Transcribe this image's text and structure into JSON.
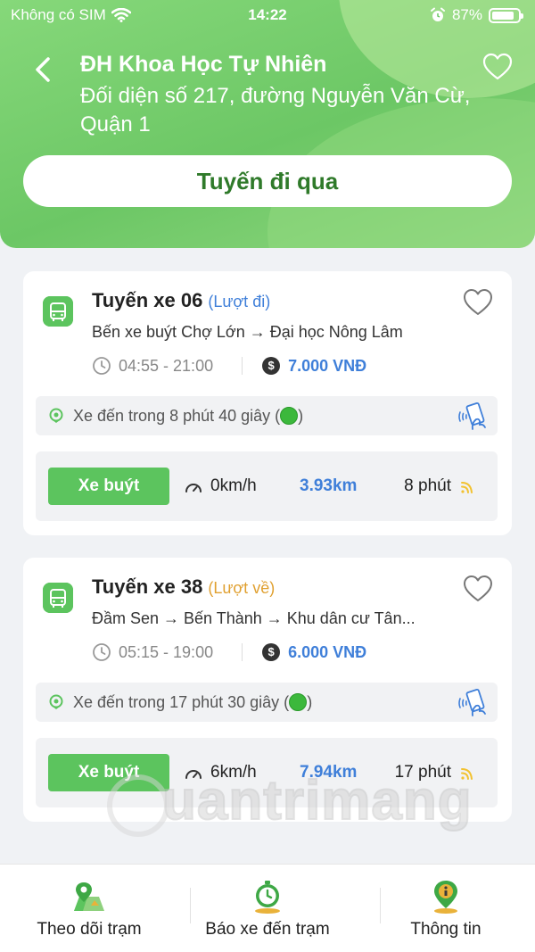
{
  "status_bar": {
    "carrier": "Không có SIM",
    "time": "14:22",
    "battery": "87%",
    "battery_level": 0.87
  },
  "header": {
    "title": "ĐH Khoa Học Tự Nhiên",
    "address": "Đối diện số 217, đường Nguyễn Văn Cừ, Quận 1",
    "routes_button": "Tuyến đi qua"
  },
  "routes": [
    {
      "name": "Tuyến xe 06",
      "direction": "(Lượt đi)",
      "path": "Bến xe buýt Chợ Lớn → Đại học Nông Lâm",
      "hours": "04:55 - 21:00",
      "price": "7.000 VNĐ",
      "arrival": "Xe đến trong 8 phút 40 giây (",
      "arrival_end": ")",
      "vehicle_type": "Xe buýt",
      "speed": "0km/h",
      "distance": "3.93km",
      "eta": "8 phút"
    },
    {
      "name": "Tuyến xe 38",
      "direction": "(Lượt về)",
      "path": "Đầm Sen → Bến Thành → Khu dân cư Tân...",
      "hours": "05:15 - 19:00",
      "price": "6.000 VNĐ",
      "arrival": "Xe đến trong 17 phút 30 giây (",
      "arrival_end": ")",
      "vehicle_type": "Xe buýt",
      "speed": "6km/h",
      "distance": "7.94km",
      "eta": "17 phút"
    }
  ],
  "watermark": "uantrimang",
  "bottom_nav": [
    {
      "label": "Theo dõi trạm",
      "icon": "map-pin-icon"
    },
    {
      "label": "Báo xe đến trạm",
      "icon": "timer-icon"
    },
    {
      "label": "Thông tin",
      "icon": "info-pin-icon"
    }
  ],
  "colors": {
    "primary_green": "#5cc45e",
    "header_green": "#6cc765",
    "link_blue": "#3f7fd9",
    "return_orange": "#e0a030"
  }
}
